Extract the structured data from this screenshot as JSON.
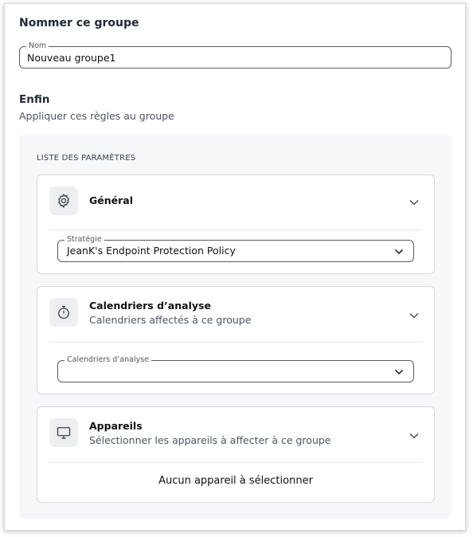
{
  "name_section": {
    "title": "Nommer ce groupe",
    "field_label": "Nom",
    "field_value": "Nouveau groupe1"
  },
  "rules_section": {
    "title": "Enfin",
    "subtitle": "Appliquer ces règles au groupe"
  },
  "params": {
    "label": "LISTE DES PARAMÈTRES",
    "general": {
      "title": "Général",
      "icon": "gear-icon",
      "strategy_label": "Stratégie",
      "strategy_value": "JeanK's Endpoint Protection Policy"
    },
    "schedules": {
      "title": "Calendriers d’analyse",
      "subtitle": "Calendriers affectés à ce groupe",
      "icon": "stopwatch-icon",
      "select_label": "Calendriers d’analyse",
      "select_value": ""
    },
    "devices": {
      "title": "Appareils",
      "subtitle": "Sélectionner les appareils à affecter à ce groupe",
      "icon": "monitor-icon",
      "empty_message": "Aucun appareil à sélectionner"
    }
  }
}
